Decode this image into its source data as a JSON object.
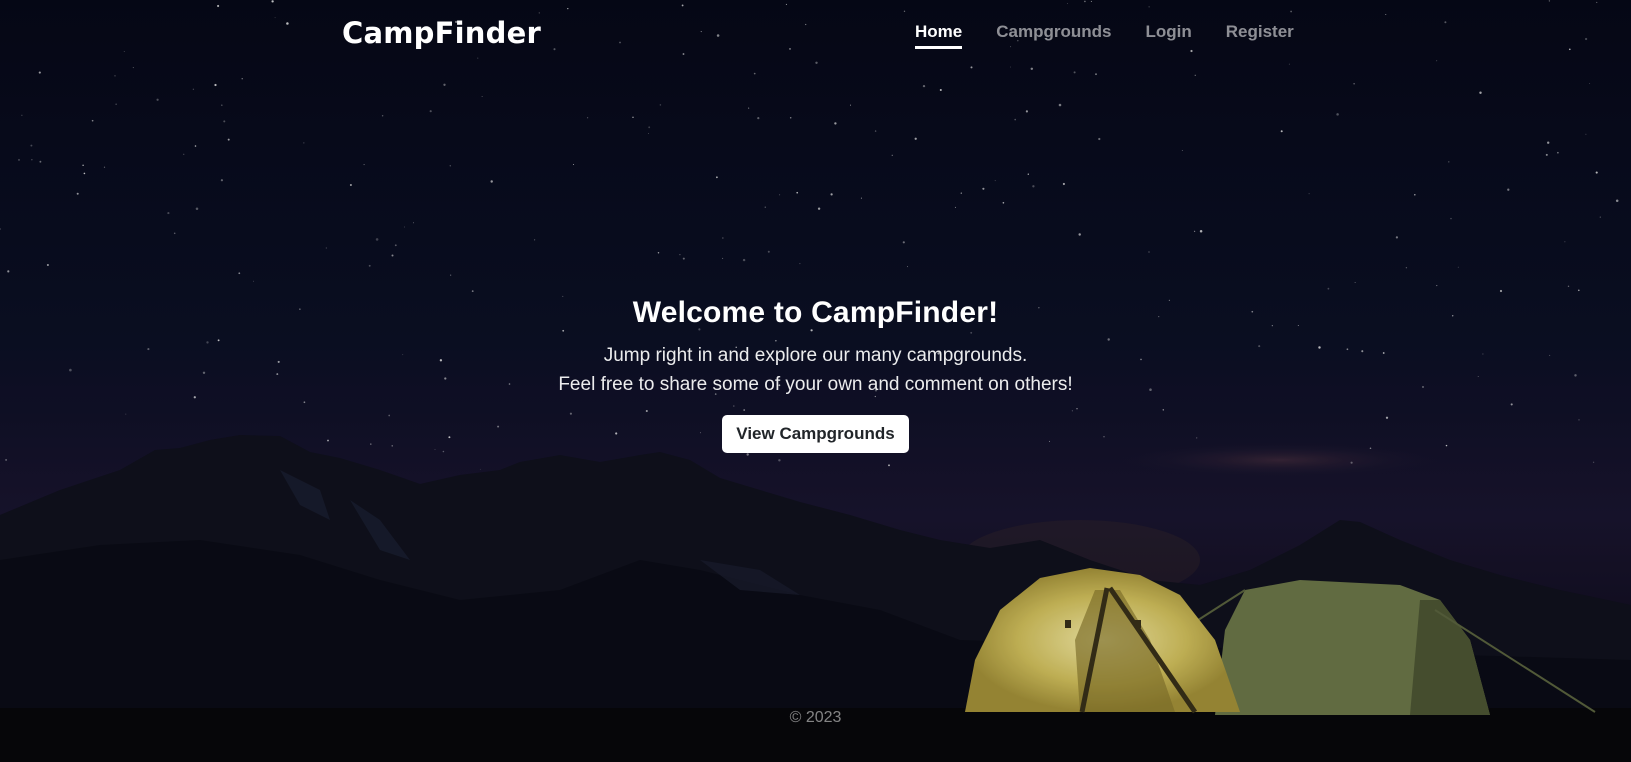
{
  "navbar": {
    "brand": "CampFinder",
    "links": [
      {
        "label": "Home",
        "active": true
      },
      {
        "label": "Campgrounds",
        "active": false
      },
      {
        "label": "Login",
        "active": false
      },
      {
        "label": "Register",
        "active": false
      }
    ]
  },
  "hero": {
    "title": "Welcome to CampFinder!",
    "line1": "Jump right in and explore our many campgrounds.",
    "line2": "Feel free to share some of your own and comment on others!",
    "button_label": "View Campgrounds"
  },
  "footer": {
    "copyright": "© 2023"
  },
  "colors": {
    "sky_top": "#070a1a",
    "sky_bottom": "#14142a",
    "tent_glow": "#e8d97a",
    "tent_dim": "#7e8a55"
  }
}
